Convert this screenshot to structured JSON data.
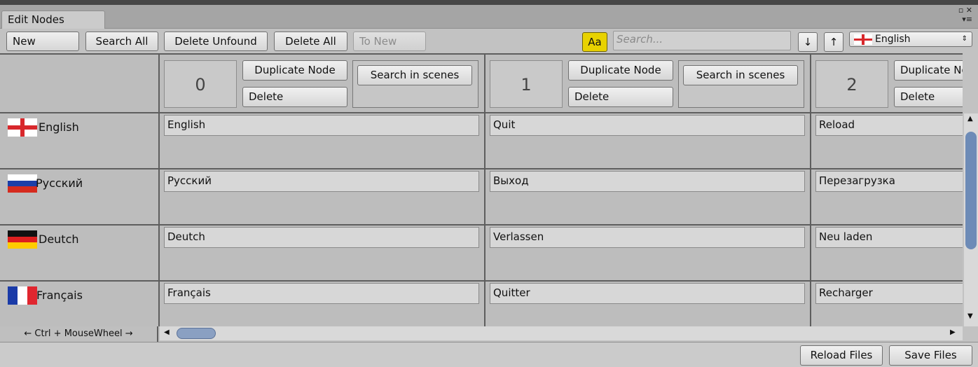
{
  "window": {
    "tab_title": "Edit Nodes",
    "top_icons": "▫ ✕",
    "menu_icon": "▾≡"
  },
  "toolbar": {
    "new_label": "New",
    "search_all_label": "Search All",
    "delete_unfound_label": "Delete Unfound",
    "delete_all_label": "Delete All",
    "to_new_label": "To New",
    "case_toggle_label": "Aa",
    "search_placeholder": "Search...",
    "down_label": "↓",
    "up_label": "↑",
    "language_selected": "English"
  },
  "columns": [
    {
      "number": "0",
      "duplicate_label": "Duplicate Node",
      "delete_label": "Delete",
      "search_scenes_label": "Search in scenes"
    },
    {
      "number": "1",
      "duplicate_label": "Duplicate Node",
      "delete_label": "Delete",
      "search_scenes_label": "Search in scenes"
    },
    {
      "number": "2",
      "duplicate_label": "Duplicate Node",
      "delete_label": "Delete"
    }
  ],
  "languages": [
    {
      "name": "English",
      "flag": "england-flag-icon",
      "values": [
        "English",
        "Quit",
        "Reload"
      ]
    },
    {
      "name": "Русский",
      "flag": "russia-flag-icon",
      "values": [
        "Русский",
        "Выход",
        "Перезагрузка"
      ]
    },
    {
      "name": "Deutch",
      "flag": "germany-flag-icon",
      "values": [
        "Deutch",
        "Verlassen",
        "Neu laden"
      ]
    },
    {
      "name": "Français",
      "flag": "france-flag-icon",
      "values": [
        "Français",
        "Quitter",
        "Recharger"
      ]
    }
  ],
  "scroll_hint": "← Ctrl + MouseWheel →",
  "footer": {
    "reload_label": "Reload Files",
    "save_label": "Save Files"
  },
  "colors": {
    "accent_toggle": "#e8d200",
    "scrollbar_thumb": "#6d8bb7"
  }
}
